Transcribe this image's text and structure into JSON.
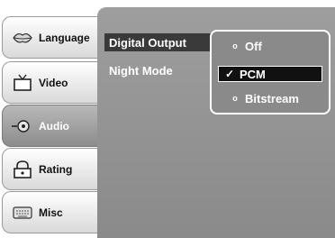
{
  "sidebar": {
    "items": [
      {
        "label": "Language",
        "icon": "lips-icon",
        "active": false
      },
      {
        "label": "Video",
        "icon": "tv-icon",
        "active": false
      },
      {
        "label": "Audio",
        "icon": "speaker-icon",
        "active": true
      },
      {
        "label": "Rating",
        "icon": "lock-icon",
        "active": false
      },
      {
        "label": "Misc",
        "icon": "keyboard-icon",
        "active": false
      }
    ]
  },
  "settings": [
    {
      "label": "Digital Output",
      "selected": true
    },
    {
      "label": "Night Mode",
      "selected": false
    }
  ],
  "popup": {
    "options": [
      {
        "label": "Off",
        "mark": "o",
        "selected": false
      },
      {
        "label": "PCM",
        "mark": "✓",
        "selected": true
      },
      {
        "label": "Bitstream",
        "mark": "o",
        "selected": false
      }
    ]
  },
  "colors": {
    "panel": "#8f8f8f",
    "selected_bg": "#111111",
    "text": "#ffffff"
  }
}
